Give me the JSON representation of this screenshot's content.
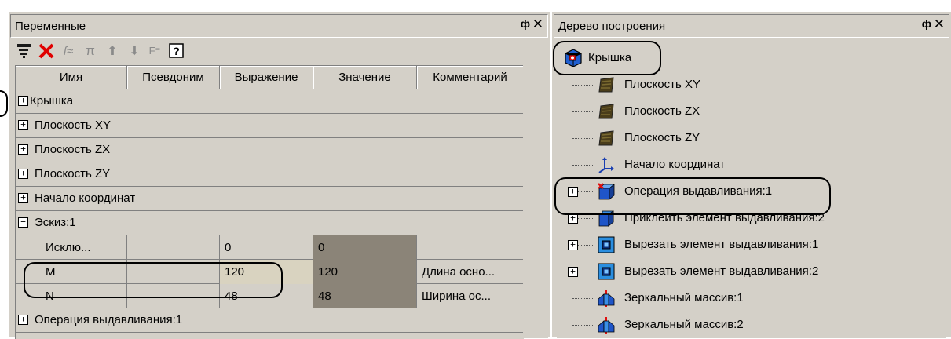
{
  "variables_panel": {
    "title": "Переменные",
    "pin_glyph": "ф",
    "close_glyph": "✕",
    "toolbar_icons": [
      "tree-view-icon",
      "delete-icon",
      "function-icon",
      "pi-icon",
      "arrow-up-icon",
      "arrow-down-icon",
      "formula-icon",
      "help-icon"
    ],
    "columns": [
      "Имя",
      "Псевдоним",
      "Выражение",
      "Значение",
      "Комментарий"
    ],
    "rows": [
      {
        "type": "group",
        "expander": "+",
        "label": "Крышка"
      },
      {
        "type": "group",
        "expander": "+",
        "label": "Плоскость XY"
      },
      {
        "type": "group",
        "expander": "+",
        "label": "Плоскость ZX"
      },
      {
        "type": "group",
        "expander": "+",
        "label": "Плоскость ZY"
      },
      {
        "type": "group",
        "expander": "+",
        "label": "Начало координат"
      },
      {
        "type": "group",
        "expander": "−",
        "label": "Эскиз:1"
      },
      {
        "type": "var",
        "name": "Исклю...",
        "alias": "",
        "expression": "0",
        "value": "0",
        "comment": ""
      },
      {
        "type": "var",
        "name": "M",
        "alias": "",
        "expression": "120",
        "value": "120",
        "comment": "Длина осно..."
      },
      {
        "type": "var",
        "name": "N",
        "alias": "",
        "expression": "48",
        "value": "48",
        "comment": "Ширина ос..."
      },
      {
        "type": "group",
        "expander": "+",
        "label": "Операция выдавливания:1"
      }
    ]
  },
  "tree_panel": {
    "title": "Дерево построения",
    "pin_glyph": "ф",
    "close_glyph": "✕",
    "nodes": [
      {
        "label": "Крышка",
        "icon": "part-icon",
        "expander": ""
      },
      {
        "label": "Плоскость XY",
        "icon": "plane-icon",
        "expander": ""
      },
      {
        "label": "Плоскость ZX",
        "icon": "plane-icon",
        "expander": ""
      },
      {
        "label": "Плоскость ZY",
        "icon": "plane-icon",
        "expander": ""
      },
      {
        "label": "Начало координат",
        "icon": "origin-axes-icon",
        "expander": ""
      },
      {
        "label": "Операция выдавливания:1",
        "icon": "extrude-icon",
        "expander": "+"
      },
      {
        "label": "Приклеить элемент выдавливания:2",
        "icon": "boss-extrude-icon",
        "expander": "+"
      },
      {
        "label": "Вырезать элемент выдавливания:1",
        "icon": "cut-extrude-icon",
        "expander": "+"
      },
      {
        "label": "Вырезать элемент выдавливания:2",
        "icon": "cut-extrude-icon",
        "expander": "+"
      },
      {
        "label": "Зеркальный массив:1",
        "icon": "mirror-array-icon",
        "expander": ""
      },
      {
        "label": "Зеркальный массив:2",
        "icon": "mirror-array-icon",
        "expander": ""
      }
    ]
  },
  "colors": {
    "panel_bg": "#d4d0c8",
    "computed_cell_bg": "#8b8478",
    "delete_red": "#e00000"
  }
}
